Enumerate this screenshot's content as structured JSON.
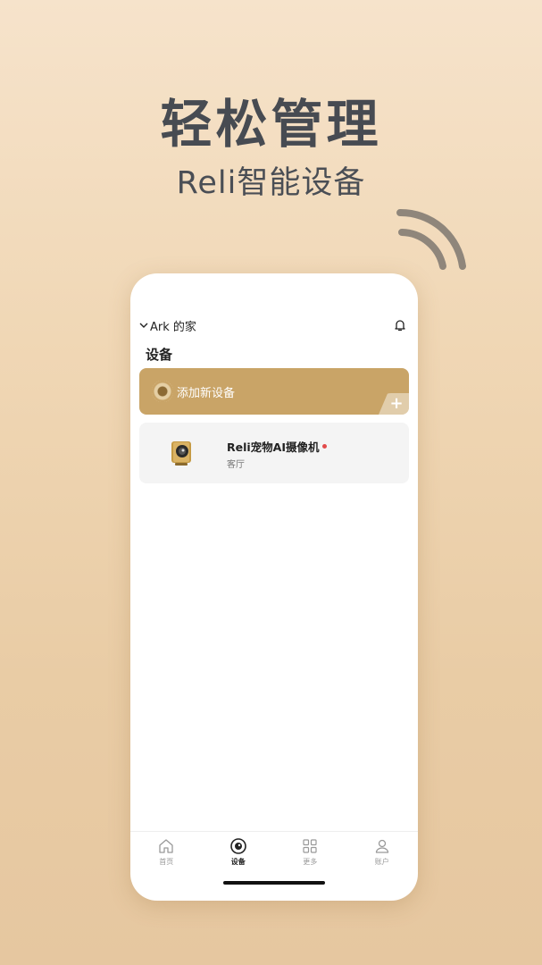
{
  "promo": {
    "headline": "轻松管理",
    "subline": "Reli智能设备"
  },
  "phone": {
    "home_name": "Ark 的家",
    "section_title": "设备",
    "add_device": {
      "label": "添加新设备",
      "plus": "+"
    },
    "devices": [
      {
        "name": "Reli宠物AI摄像机",
        "room": "客厅",
        "status_color": "#e24a4a"
      }
    ],
    "tabs": [
      {
        "label": "首页",
        "icon": "home-icon",
        "active": false
      },
      {
        "label": "设备",
        "icon": "camera-icon",
        "active": true
      },
      {
        "label": "更多",
        "icon": "grid-icon",
        "active": false
      },
      {
        "label": "账户",
        "icon": "user-icon",
        "active": false
      }
    ]
  },
  "colors": {
    "accent": "#c9a467",
    "background": "#f0d7b5",
    "headline": "#474b52"
  }
}
